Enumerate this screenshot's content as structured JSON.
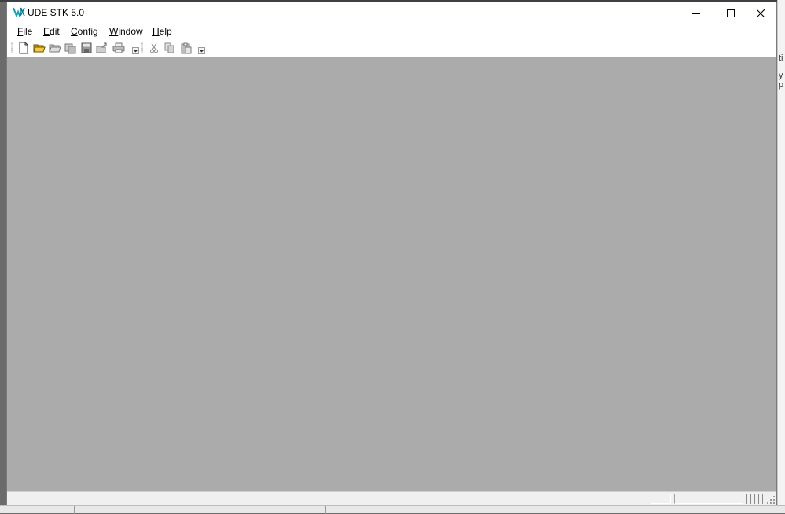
{
  "window": {
    "title": "UDE STK 5.0"
  },
  "menu": {
    "items": [
      {
        "id": "file",
        "accel": "F",
        "rest": "ile"
      },
      {
        "id": "edit",
        "accel": "E",
        "rest": "dit"
      },
      {
        "id": "config",
        "accel": "C",
        "rest": "onfig"
      },
      {
        "id": "window",
        "accel": "W",
        "rest": "indow"
      },
      {
        "id": "help",
        "accel": "H",
        "rest": "elp"
      }
    ]
  },
  "toolbar": {
    "icons": [
      "new-file-icon",
      "open-folder-icon",
      "open-workspace-icon",
      "save-workspace-icon",
      "save-icon",
      "export-icon",
      "print-icon",
      "cut-icon",
      "copy-icon",
      "paste-icon"
    ]
  },
  "background_fragments": {
    "right_text": [
      "ti",
      "y",
      "p"
    ]
  },
  "colors": {
    "workspace": "#ababab",
    "accent_icon": "#1a9fb5"
  }
}
